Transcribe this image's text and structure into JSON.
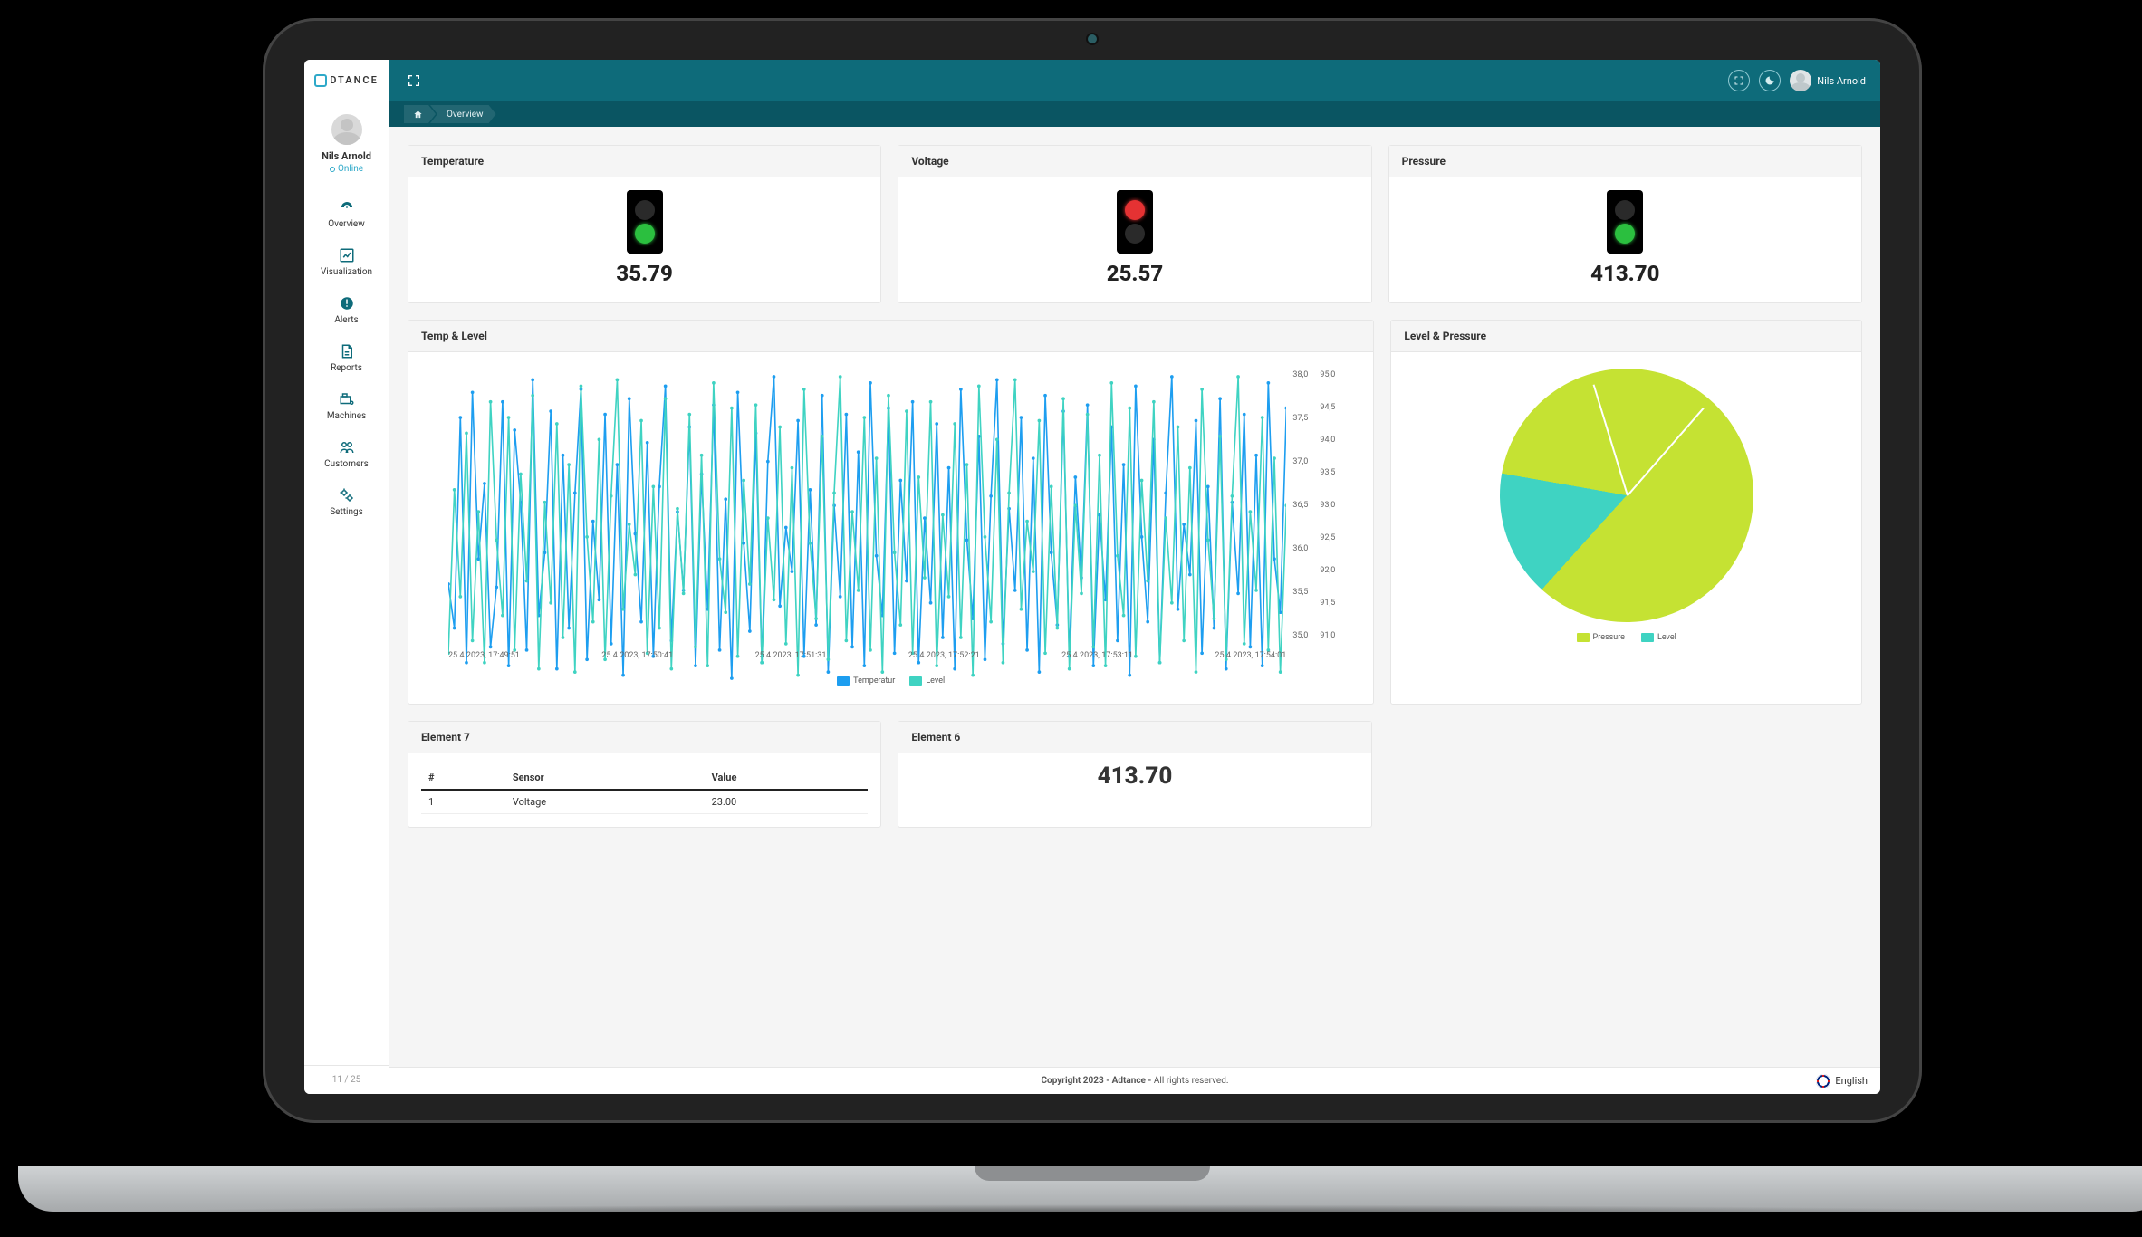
{
  "brand": {
    "mark": "A",
    "name": "DTANCE"
  },
  "user": {
    "name": "Nils Arnold",
    "status": "Online"
  },
  "sidebar": {
    "items": [
      {
        "key": "overview",
        "label": "Overview",
        "icon": "dashboard-icon"
      },
      {
        "key": "visualization",
        "label": "Visualization",
        "icon": "chart-icon"
      },
      {
        "key": "alerts",
        "label": "Alerts",
        "icon": "alert-icon"
      },
      {
        "key": "reports",
        "label": "Reports",
        "icon": "report-icon"
      },
      {
        "key": "machines",
        "label": "Machines",
        "icon": "machine-icon"
      },
      {
        "key": "customers",
        "label": "Customers",
        "icon": "customers-icon"
      },
      {
        "key": "settings",
        "label": "Settings",
        "icon": "settings-icon"
      }
    ],
    "page_counter": "11 / 25"
  },
  "topbar": {
    "user_name": "Nils Arnold"
  },
  "breadcrumbs": [
    {
      "label": "Home",
      "icon": "home-icon"
    },
    {
      "label": "Overview"
    }
  ],
  "gauges": [
    {
      "title": "Temperature",
      "value": "35.79",
      "status": "green"
    },
    {
      "title": "Voltage",
      "value": "25.57",
      "status": "red"
    },
    {
      "title": "Pressure",
      "value": "413.70",
      "status": "green"
    }
  ],
  "chart_data": [
    {
      "id": "temp_level",
      "type": "line",
      "title": "Temp & Level",
      "x_ticks": [
        "25.4.2023, 17:49:51",
        "25.4.2023, 17:50:41",
        "25.4.2023, 17:51:31",
        "25.4.2023, 17:52:21",
        "25.4.2023, 17:53:11",
        "25.4.2023, 17:54:01"
      ],
      "axes": [
        {
          "side": "left",
          "label": "Temperatur",
          "min": 35.0,
          "max": 38.0,
          "ticks": [
            35.0,
            35.5,
            36.0,
            36.5,
            37.0,
            37.5,
            38.0
          ],
          "color": "#1d9ef0"
        },
        {
          "side": "right",
          "label": "Level",
          "min": 91.0,
          "max": 95.0,
          "ticks": [
            91.0,
            91.5,
            92.0,
            92.5,
            93.0,
            93.5,
            94.0,
            94.5,
            95.0
          ],
          "color": "#3fd3c2"
        }
      ],
      "series": [
        {
          "name": "Temperatur",
          "color": "#1d9ef0",
          "axis": "left",
          "y_norm": [
            0.32,
            0.18,
            0.85,
            0.07,
            0.93,
            0.4,
            0.64,
            0.12,
            0.31,
            0.9,
            0.06,
            0.81,
            0.58,
            0.11,
            0.97,
            0.22,
            0.42,
            0.87,
            0.05,
            0.73,
            0.18,
            0.61,
            0.94,
            0.08,
            0.52,
            0.27,
            0.86,
            0.13,
            0.7,
            0.03,
            0.91,
            0.48,
            0.2,
            0.77,
            0.09,
            0.63,
            0.95,
            0.14,
            0.55,
            0.3,
            0.82,
            0.06,
            0.67,
            0.24,
            0.89,
            0.11,
            0.59,
            0.02,
            0.93,
            0.45,
            0.17,
            0.8,
            0.07,
            0.71,
            0.98,
            0.25,
            0.5,
            0.36,
            0.84,
            0.09,
            0.62,
            0.19,
            0.92,
            0.04,
            0.57,
            0.28,
            0.86,
            0.12,
            0.74,
            0.06,
            0.96,
            0.41,
            0.22,
            0.88,
            0.1,
            0.65,
            0.33,
            0.9,
            0.07,
            0.53,
            0.26,
            0.83,
            0.15,
            0.69,
            0.05,
            0.94,
            0.46,
            0.21,
            0.79,
            0.08,
            0.6,
            0.97,
            0.13,
            0.56,
            0.3,
            0.85,
            0.11,
            0.72,
            0.04,
            0.92,
            0.42,
            0.19,
            0.87,
            0.09,
            0.66,
            0.34,
            0.89,
            0.06,
            0.54,
            0.27,
            0.82,
            0.14,
            0.7,
            0.03,
            0.95,
            0.47,
            0.2,
            0.78,
            0.07,
            0.61,
            0.98,
            0.24,
            0.51,
            0.35,
            0.84,
            0.1,
            0.63,
            0.18,
            0.91,
            0.05,
            0.58,
            0.29,
            0.86,
            0.12,
            0.73,
            0.06,
            0.96,
            0.4,
            0.23,
            0.88
          ]
        },
        {
          "name": "Level",
          "color": "#3fd3c2",
          "axis": "right",
          "y_norm": [
            0.1,
            0.62,
            0.28,
            0.8,
            0.14,
            0.55,
            0.07,
            0.9,
            0.46,
            0.22,
            0.85,
            0.11,
            0.67,
            0.33,
            0.92,
            0.05,
            0.58,
            0.26,
            0.83,
            0.15,
            0.7,
            0.04,
            0.95,
            0.47,
            0.2,
            0.78,
            0.08,
            0.6,
            0.97,
            0.24,
            0.51,
            0.35,
            0.84,
            0.1,
            0.63,
            0.18,
            0.91,
            0.05,
            0.56,
            0.29,
            0.86,
            0.12,
            0.73,
            0.06,
            0.96,
            0.4,
            0.23,
            0.88,
            0.09,
            0.65,
            0.32,
            0.89,
            0.07,
            0.53,
            0.27,
            0.82,
            0.13,
            0.69,
            0.03,
            0.94,
            0.45,
            0.21,
            0.79,
            0.08,
            0.61,
            0.98,
            0.14,
            0.55,
            0.3,
            0.85,
            0.11,
            0.72,
            0.04,
            0.92,
            0.42,
            0.19,
            0.87,
            0.1,
            0.66,
            0.34,
            0.9,
            0.06,
            0.54,
            0.28,
            0.83,
            0.15,
            0.7,
            0.03,
            0.95,
            0.47,
            0.2,
            0.78,
            0.07,
            0.61,
            0.97,
            0.24,
            0.52,
            0.36,
            0.84,
            0.1,
            0.63,
            0.18,
            0.91,
            0.05,
            0.57,
            0.29,
            0.86,
            0.12,
            0.73,
            0.06,
            0.96,
            0.41,
            0.22,
            0.88,
            0.09,
            0.65,
            0.33,
            0.9,
            0.07,
            0.53,
            0.26,
            0.82,
            0.14,
            0.69,
            0.04,
            0.94,
            0.46,
            0.21,
            0.79,
            0.08,
            0.6,
            0.98,
            0.13,
            0.55,
            0.3,
            0.85,
            0.11,
            0.72,
            0.04,
            0.57
          ]
        }
      ],
      "legend": [
        {
          "name": "Temperatur",
          "color": "#1d9ef0"
        },
        {
          "name": "Level",
          "color": "#3fd3c2"
        }
      ]
    },
    {
      "id": "level_pressure",
      "type": "pie",
      "title": "Level & Pressure",
      "slices": [
        {
          "name": "Pressure",
          "color": "#c5e233",
          "value": 84
        },
        {
          "name": "Level",
          "color": "#3fd3c2",
          "value": 16
        }
      ],
      "legend": [
        {
          "name": "Pressure",
          "color": "#c5e233"
        },
        {
          "name": "Level",
          "color": "#3fd3c2"
        }
      ]
    }
  ],
  "elements": {
    "el7": {
      "title": "Element 7",
      "columns": [
        "#",
        "Sensor",
        "Value"
      ],
      "rows": [
        [
          "1",
          "Voltage",
          "23.00"
        ]
      ]
    },
    "el6": {
      "title": "Element 6",
      "value": "413.70"
    }
  },
  "footer": {
    "copyright_bold": "Copyright 2023 - Adtance - ",
    "copyright_rest": "All rights reserved.",
    "language": "English"
  }
}
